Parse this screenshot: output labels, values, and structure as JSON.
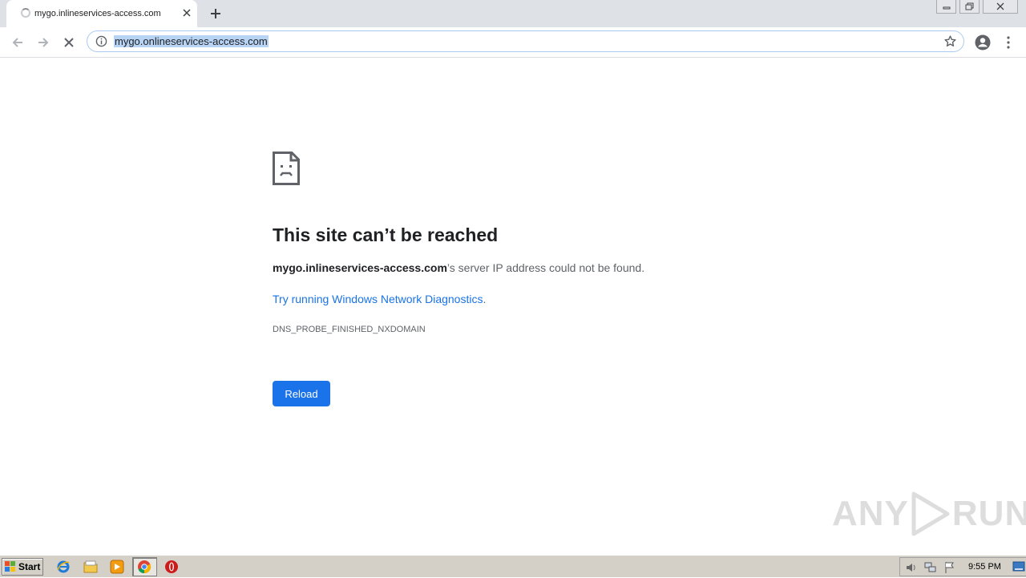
{
  "tab": {
    "title": "mygo.inlineservices-access.com"
  },
  "omnibox": {
    "url": "mygo.onlineservices-access.com"
  },
  "error": {
    "title": "This site can’t be reached",
    "host": "mygo.inlineservices-access.com",
    "message_suffix": "’s server IP address could not be found.",
    "link_text": "Try running Windows Network Diagnostics",
    "link_period": ".",
    "code": "DNS_PROBE_FINISHED_NXDOMAIN",
    "reload_label": "Reload"
  },
  "watermark": {
    "text_left": "ANY",
    "text_right": "RUN"
  },
  "taskbar": {
    "start_label": "Start",
    "clock": "9:55 PM",
    "icons": [
      "ie-icon",
      "folder-icon",
      "media-player-icon",
      "chrome-icon",
      "opera-icon"
    ]
  },
  "colors": {
    "accent": "#1a73e8",
    "url_highlight": "#b8d4f5",
    "tabstrip": "#dee1e6",
    "taskbar": "#d4d0c8"
  }
}
